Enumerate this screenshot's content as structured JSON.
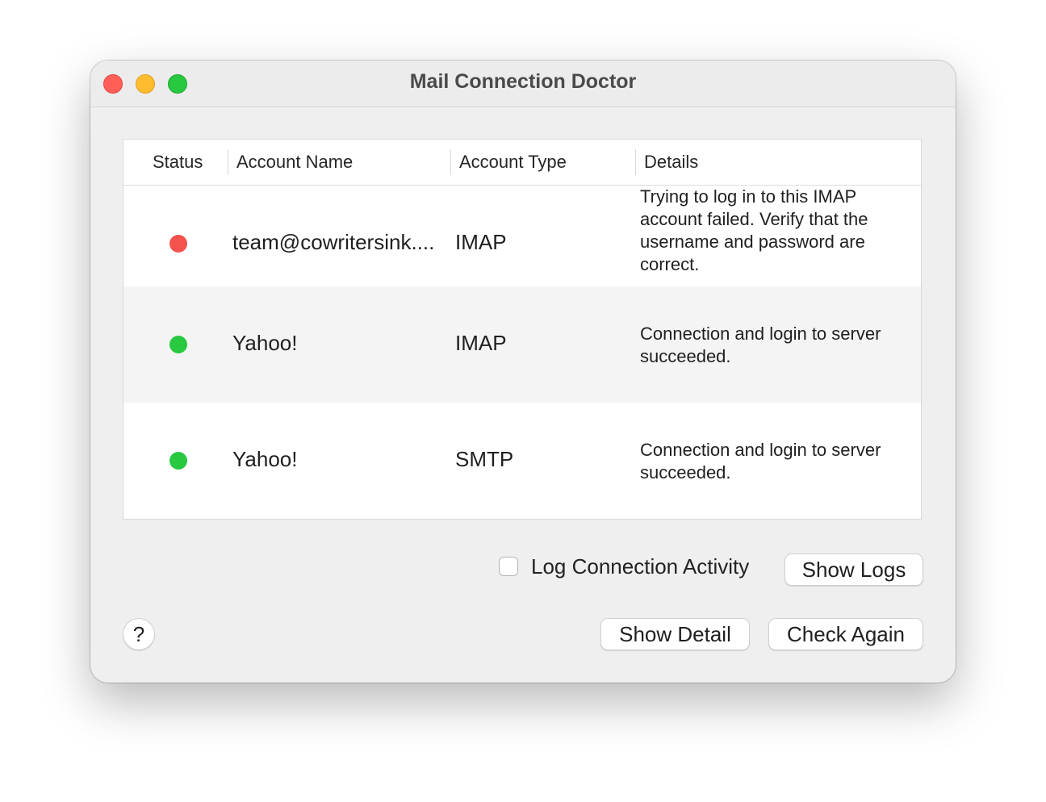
{
  "window": {
    "title": "Mail Connection Doctor"
  },
  "table": {
    "columns": [
      "Status",
      "Account Name",
      "Account Type",
      "Details"
    ],
    "rows": [
      {
        "status": "failed",
        "status_color": "#f4524d",
        "account_name": "team@cowritersink....",
        "account_type": "IMAP",
        "details": "Trying to log in to this IMAP account failed. Verify that the username and password are correct."
      },
      {
        "status": "ok",
        "status_color": "#28c840",
        "account_name": "Yahoo!",
        "account_type": "IMAP",
        "details": "Connection and login to server succeeded."
      },
      {
        "status": "ok",
        "status_color": "#28c840",
        "account_name": "Yahoo!",
        "account_type": "SMTP",
        "details": "Connection and login to server succeeded."
      }
    ]
  },
  "log_activity": {
    "label": "Log Connection Activity",
    "checked": false
  },
  "buttons": {
    "show_logs": "Show Logs",
    "show_detail": "Show Detail",
    "check_again": "Check Again",
    "help": "?"
  },
  "colors": {
    "close": "#ff5f57",
    "minimize": "#febc2e",
    "zoom": "#28c840"
  }
}
